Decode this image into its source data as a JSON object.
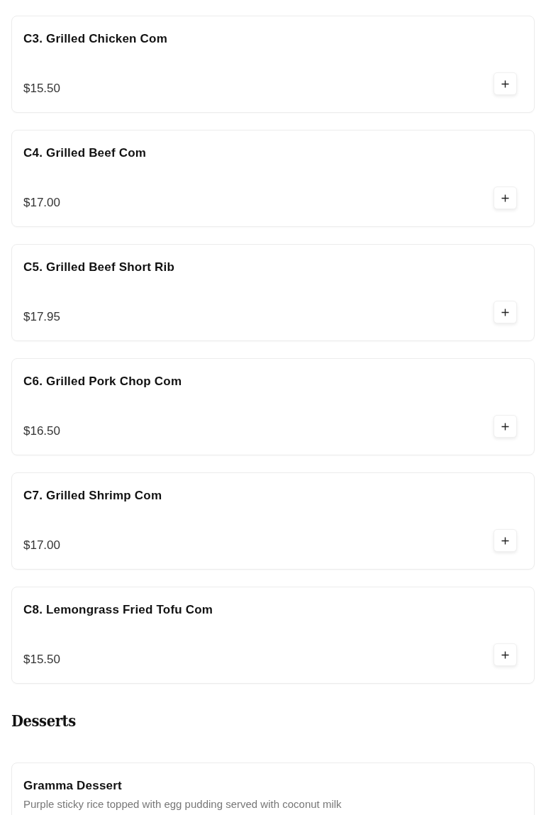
{
  "sections": [
    {
      "items": [
        {
          "name": "C3. Grilled Chicken Com",
          "price": "$15.50"
        },
        {
          "name": "C4. Grilled Beef Com",
          "price": "$17.00"
        },
        {
          "name": "C5. Grilled Beef Short Rib",
          "price": "$17.95"
        },
        {
          "name": "C6. Grilled Pork Chop Com",
          "price": "$16.50"
        },
        {
          "name": "C7. Grilled Shrimp Com",
          "price": "$17.00"
        },
        {
          "name": "C8. Lemongrass Fried Tofu Com",
          "price": "$15.50"
        }
      ]
    },
    {
      "heading": "Desserts",
      "items": [
        {
          "name": "Gramma Dessert",
          "description": "Purple sticky rice topped with egg pudding served with coconut milk"
        }
      ]
    }
  ]
}
